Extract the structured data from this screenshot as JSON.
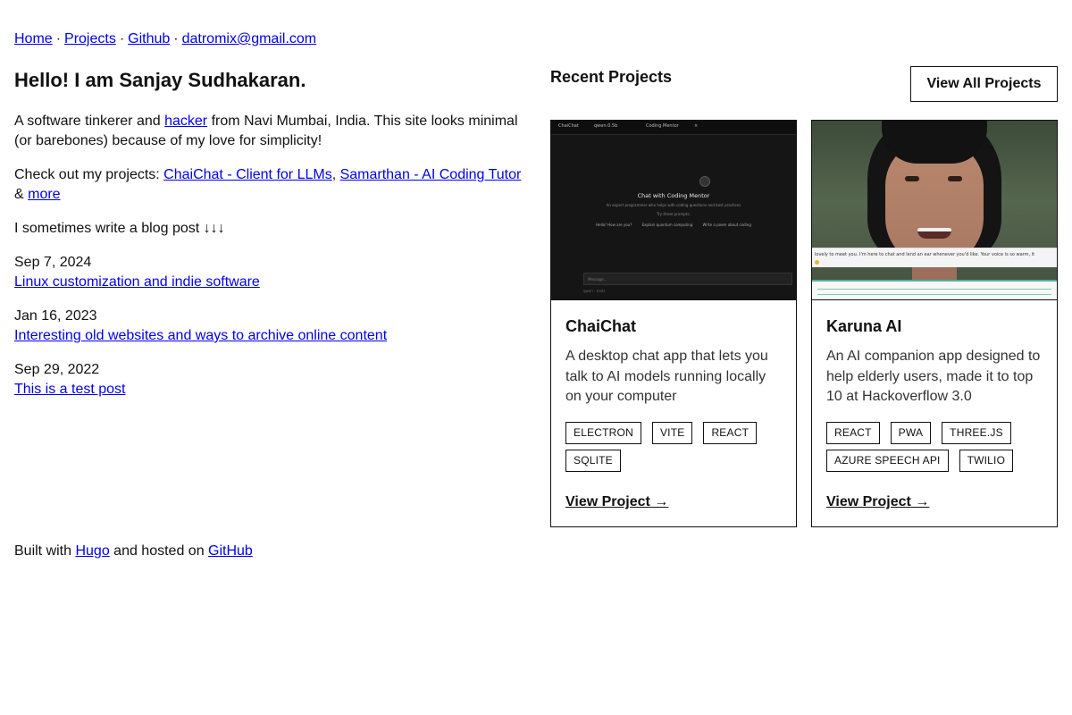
{
  "nav": {
    "home": "Home",
    "projects": "Projects",
    "github": "Github",
    "email": "datromix@gmail.com",
    "separator": "·"
  },
  "intro": {
    "heading": "Hello! I am Sanjay Sudhakaran.",
    "line1_before": "A software tinkerer and ",
    "line1_link": "hacker",
    "line1_after": " from Navi Mumbai, India. This site looks minimal (or barebones) because of my love for simplicity!",
    "projects_before": "Check out my projects: ",
    "project_link_1": "ChaiChat - Client for LLMs",
    "projects_comma": ", ",
    "project_link_2": "Samarthan - AI Coding Tutor",
    "projects_amp": " & ",
    "projects_more": "more",
    "blog_line": "I sometimes write a blog post ↓↓↓"
  },
  "posts": [
    {
      "date": "Sep 7, 2024",
      "title": "Linux customization and indie software"
    },
    {
      "date": "Jan 16, 2023",
      "title": "Interesting old websites and ways to archive online content"
    },
    {
      "date": "Sep 29, 2022",
      "title": "This is a test post"
    }
  ],
  "footer": {
    "before": "Built with ",
    "hugo": "Hugo",
    "middle": " and hosted on ",
    "github": "GitHub"
  },
  "recent": {
    "title": "Recent Projects",
    "view_all": "View All Projects"
  },
  "projects": [
    {
      "name": "ChaiChat",
      "description": "A desktop chat app that lets you talk to AI models running locally on your computer",
      "tags": [
        "ELECTRON",
        "VITE",
        "REACT",
        "SQLITE"
      ],
      "link_label": "View Project",
      "link_arrow": "→",
      "screenshot": {
        "tab1": "qwen:0.5b",
        "tab2": "Coding Mentor",
        "tab_close": "×",
        "app_label": "ChaiChat",
        "heading": "Chat with Coding Mentor",
        "subtitle": "An expert programmer who helps with coding questions and best practices",
        "hint": "Try these prompts:",
        "chips": [
          "Hello! How are you?",
          "Explain quantum computing",
          "Write a poem about coding"
        ],
        "input_placeholder": "Message...",
        "footer": "qwen  ·  tools"
      }
    },
    {
      "name": "Karuna AI",
      "description": "An AI companion app designed to help elderly users, made it to top 10 at Hackoverflow 3.0",
      "tags": [
        "REACT",
        "PWA",
        "THREE.JS",
        "AZURE SPEECH API",
        "TWILIO"
      ],
      "link_label": "View Project",
      "link_arrow": "→",
      "screenshot": {
        "bubble": "lovely to meet you. I'm here to chat and lend an ear whenever you'd like. Your voice is so warm, it"
      }
    }
  ]
}
